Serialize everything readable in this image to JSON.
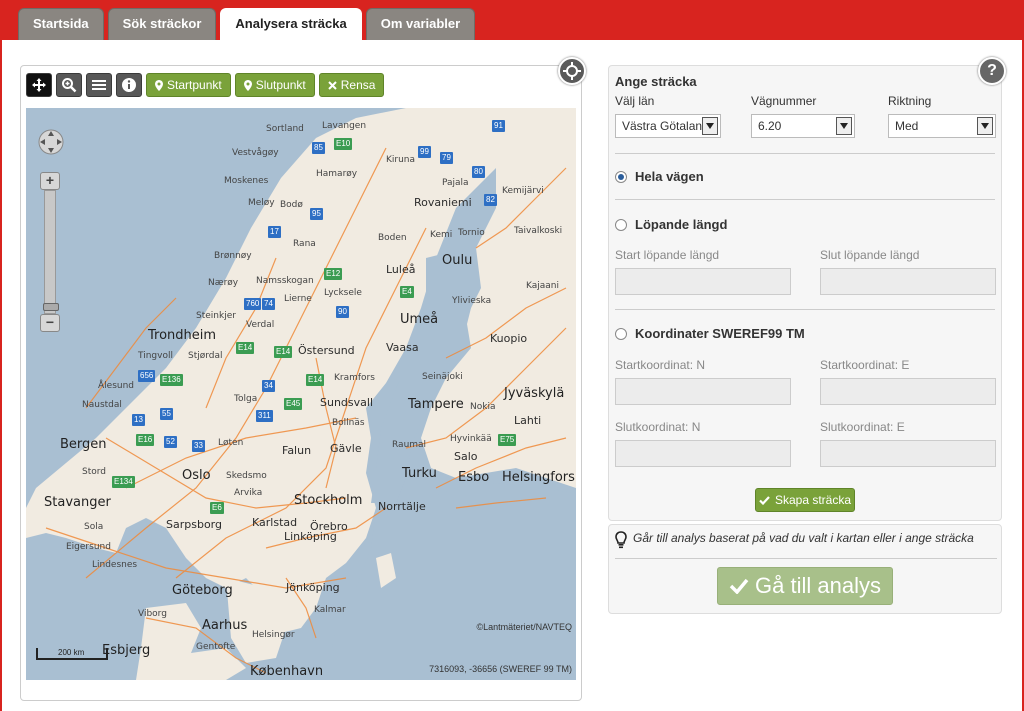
{
  "tabs": [
    {
      "label": "Startsida",
      "active": false
    },
    {
      "label": "Sök sträckor",
      "active": false
    },
    {
      "label": "Analysera sträcka",
      "active": true
    },
    {
      "label": "Om variabler",
      "active": false
    }
  ],
  "map_toolbar": {
    "tools": [
      "pan-icon",
      "zoom-icon",
      "layers-list-icon",
      "info-icon"
    ],
    "startpunkt": "Startpunkt",
    "slutpunkt": "Slutpunkt",
    "rensa": "Rensa"
  },
  "map": {
    "labels": {
      "sortland": "Sortland",
      "lavangen": "Lavangen",
      "vestvagoy": "Vestvågøy",
      "kiruna": "Kiruna",
      "hamaroy": "Hamarøy",
      "moskenes": "Moskenes",
      "pajala": "Pajala",
      "kemijarvi": "Kemijärvi",
      "melay": "Meløy",
      "bodo": "Bodø",
      "rovaniemi": "Rovaniemi",
      "tornio": "Tornio",
      "taivalkoski": "Taivalkoski",
      "rana": "Rana",
      "boden": "Boden",
      "kemi": "Kemi",
      "bronnoy": "Brønnøy",
      "namsskogan": "Namsskogan",
      "lulea": "Luleå",
      "oulu": "Oulu",
      "naeroy": "Nærøy",
      "lierne": "Lierne",
      "lycksele": "Lycksele",
      "kajaani": "Kajaani",
      "steinkjer": "Steinkjer",
      "ylivieska": "Ylivieska",
      "verdal": "Verdal",
      "umea": "Umeå",
      "trondheim": "Trondheim",
      "kuopio": "Kuopio",
      "tingvoll": "Tingvoll",
      "stjordal": "Stjørdal",
      "ostersund": "Östersund",
      "vaasa": "Vaasa",
      "alesund": "Ålesund",
      "kramfors": "Kramfors",
      "seinajoki": "Seinäjoki",
      "tolga": "Tolga",
      "naustdal": "Naustdal",
      "sundsvall": "Sundsvall",
      "jyvaskyla": "Jyväskylä",
      "tampere": "Tampere",
      "nokia": "Nokia",
      "bollnas": "Bollnäs",
      "lahti": "Lahti",
      "bergen": "Bergen",
      "loten": "Løten",
      "falun": "Falun",
      "gavle": "Gävle",
      "raumal": "Raumal",
      "hyvinkaa": "Hyvinkää",
      "stord": "Stord",
      "oslo": "Oslo",
      "skedsmo": "Skedsmo",
      "salo": "Salo",
      "turku": "Turku",
      "esbo": "Esbo",
      "helsingfors": "Helsingfors",
      "arvika": "Arvika",
      "stavanger": "Stavanger",
      "stockholm": "Stockholm",
      "norrtalje": "Norrtälje",
      "sola": "Sola",
      "sarpsborg": "Sarpsborg",
      "karlstad": "Karlstad",
      "orebro": "Örebro",
      "eigersund": "Eigersund",
      "lindesnes": "Lindesnes",
      "linkoping": "Linköping",
      "goteborg": "Göteborg",
      "jonkoping": "Jönköping",
      "viborg": "Viborg",
      "kalmar": "Kalmar",
      "aarhus": "Aarhus",
      "helsingor": "Helsingør",
      "esbjerg": "Esbjerg",
      "gentofte": "Gentofte",
      "kobenhavn": "København"
    },
    "badges": [
      "91",
      "E10",
      "85",
      "99",
      "79",
      "80",
      "82",
      "95",
      "17",
      "E12",
      "E4",
      "760",
      "74",
      "90",
      "E14",
      "E14",
      "656",
      "E136",
      "55",
      "34",
      "E14",
      "E45",
      "311",
      "13",
      "52",
      "E16",
      "33",
      "E75",
      "E134",
      "E6"
    ],
    "attribution": "©Lantmäteriet/NAVTEQ",
    "coordinates": "7316093, -36656 (SWEREF 99 TM)",
    "scale": "200 km"
  },
  "form": {
    "title": "Ange sträcka",
    "lan_label": "Välj län",
    "lan_value": "Västra Götalan",
    "vagnummer_label": "Vägnummer",
    "vagnummer_value": "6.20",
    "riktning_label": "Riktning",
    "riktning_value": "Med",
    "option_hela": "Hela vägen",
    "option_lopande": "Löpande längd",
    "start_lopande": "Start löpande längd",
    "slut_lopande": "Slut löpande längd",
    "option_koord": "Koordinater SWEREF99 TM",
    "start_n": "Startkoordinat: N",
    "start_e": "Startkoordinat: E",
    "slut_n": "Slutkoordinat: N",
    "slut_e": "Slutkoordinat: E",
    "skapa_label": "Skapa sträcka",
    "selected_option": "hela"
  },
  "analys": {
    "hint": "Går till analys baserat på vad du valt i kartan eller i ange sträcka",
    "button_label": "Gå till analys"
  },
  "colors": {
    "brand_red": "#d8241f",
    "green_button": "#7aa23a",
    "road_orange": "#ef8a3a"
  }
}
